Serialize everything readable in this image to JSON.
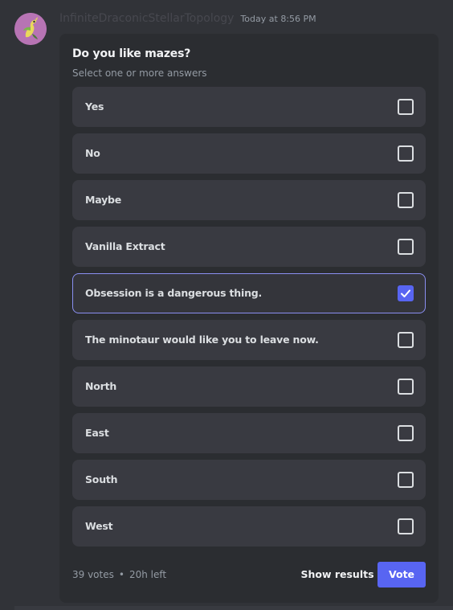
{
  "message": {
    "username": "InfiniteDraconicStellarTopology",
    "timestamp": "Today at 8:56 PM",
    "avatar_color": "#b774b4"
  },
  "poll": {
    "question": "Do you like mazes?",
    "subtitle": "Select one or more answers",
    "answers": [
      {
        "label": "Yes",
        "selected": false
      },
      {
        "label": "No",
        "selected": false
      },
      {
        "label": "Maybe",
        "selected": false
      },
      {
        "label": "Vanilla Extract",
        "selected": false
      },
      {
        "label": "Obsession is a dangerous thing.",
        "selected": true
      },
      {
        "label": "The minotaur would like you to leave now.",
        "selected": false
      },
      {
        "label": "North",
        "selected": false
      },
      {
        "label": "East",
        "selected": false
      },
      {
        "label": "South",
        "selected": false
      },
      {
        "label": "West",
        "selected": false
      }
    ],
    "votes": "39 votes",
    "separator": "•",
    "time_left": "20h left",
    "show_results_label": "Show results",
    "vote_label": "Vote",
    "accent_color": "#5865f2"
  }
}
